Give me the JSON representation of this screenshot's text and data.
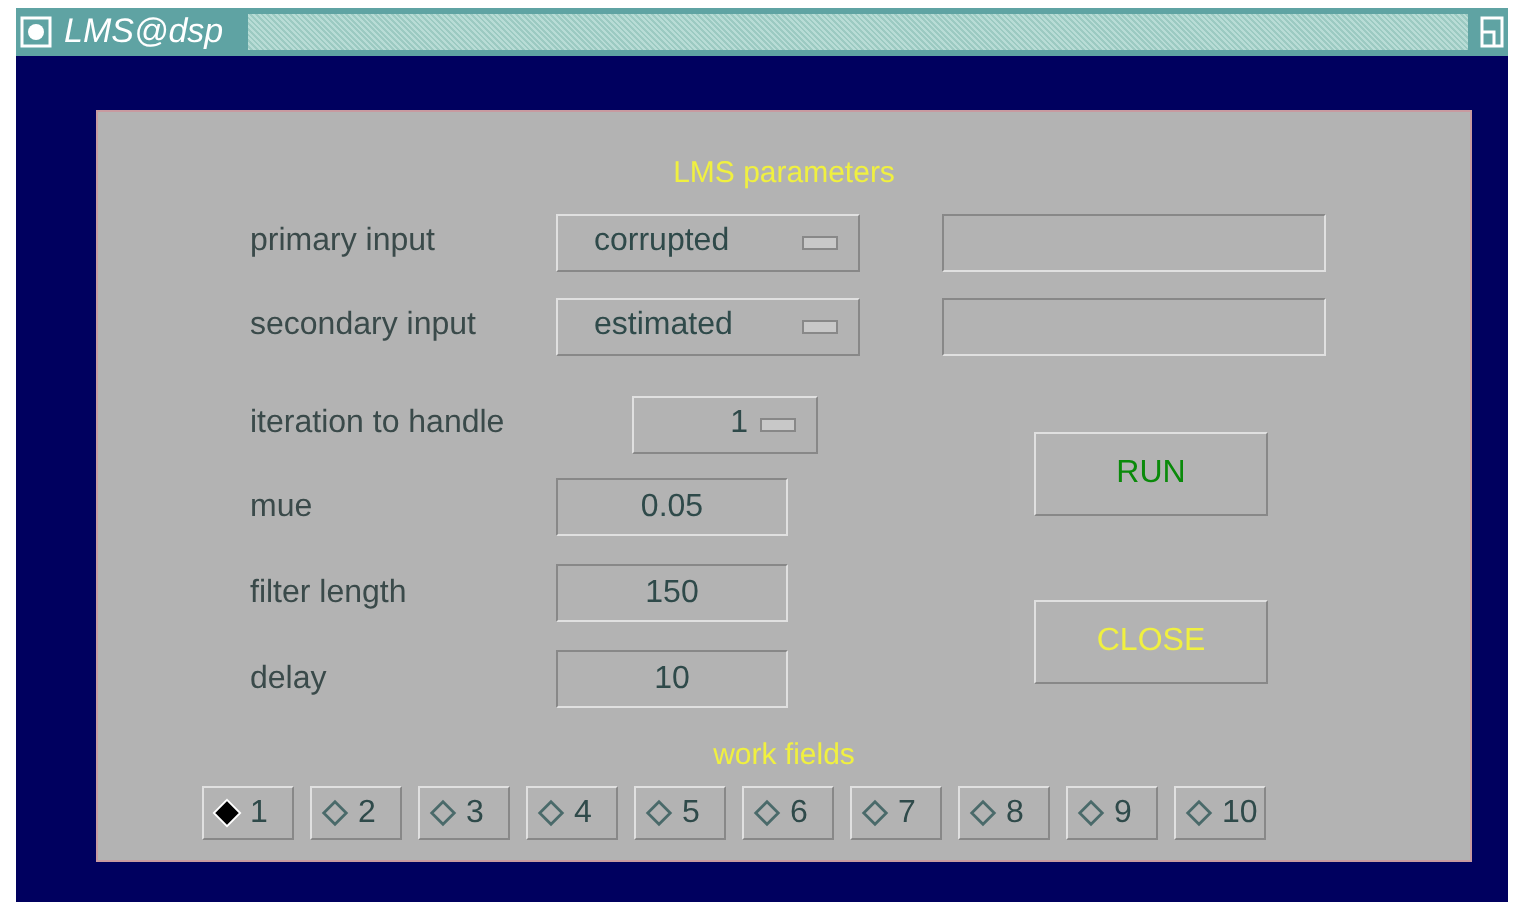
{
  "window": {
    "title": "LMS@dsp"
  },
  "section_title": "LMS parameters",
  "inputs": [
    {
      "label": "primary input",
      "value": "corrupted"
    },
    {
      "label": "secondary input",
      "value": "estimated"
    }
  ],
  "iteration": {
    "label": "iteration to handle",
    "value": "1"
  },
  "params": [
    {
      "label": "mue",
      "value": "0.05"
    },
    {
      "label": "filter length",
      "value": "150"
    },
    {
      "label": "delay",
      "value": "10"
    }
  ],
  "buttons": [
    {
      "label": "RUN",
      "kind": "run"
    },
    {
      "label": "CLOSE",
      "kind": "close"
    }
  ],
  "work_fields": {
    "title": "work fields",
    "items": [
      {
        "label": "1",
        "selected": true
      },
      {
        "label": "2",
        "selected": false
      },
      {
        "label": "3",
        "selected": false
      },
      {
        "label": "4",
        "selected": false
      },
      {
        "label": "5",
        "selected": false
      },
      {
        "label": "6",
        "selected": false
      },
      {
        "label": "7",
        "selected": false
      },
      {
        "label": "8",
        "selected": false
      },
      {
        "label": "9",
        "selected": false
      },
      {
        "label": "10",
        "selected": false
      }
    ]
  }
}
